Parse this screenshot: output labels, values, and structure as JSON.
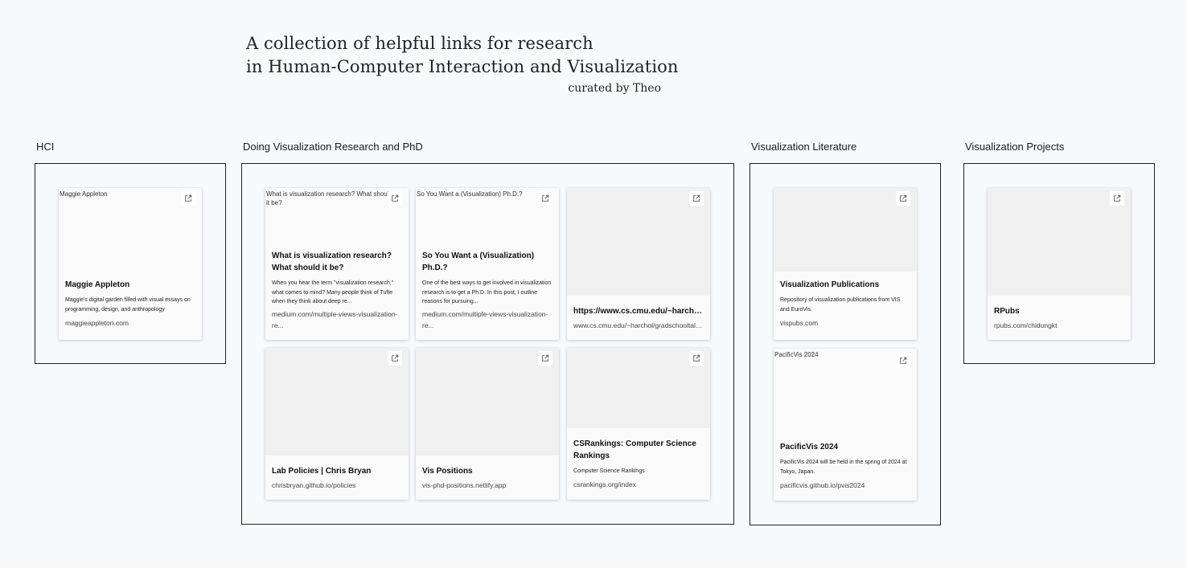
{
  "header": {
    "title_line1": "A collection of helpful links for research",
    "title_line2": "in Human-Computer Interaction and Visualization",
    "curator": "curated by Theo"
  },
  "sections": {
    "hci": {
      "title": "HCI",
      "cards": [
        {
          "image_alt": "Maggie Appleton",
          "title": "Maggie Appleton",
          "description": "Maggie's digital garden filled with visual essays on programming, design, and anthropology",
          "url": "maggieappleton.com"
        }
      ]
    },
    "phd": {
      "title": "Doing Visualization Research and PhD",
      "cards": [
        {
          "image_alt": "What is visualization research? What should it be?",
          "title": "What is visualization research? What should it be?",
          "description": "When you hear the term \"visualization research,\" what comes to mind? Many people think of Tufte when they think about deep re...",
          "url": "medium.com/multiple-views-visualization-re..."
        },
        {
          "image_alt": "So You Want a (Visualization) Ph.D.?",
          "title": "So You Want a (Visualization) Ph.D.?",
          "description": "One of the best ways to get involved in visualization research is to get a Ph.D. In this post, I outline reasons for pursuing...",
          "url": "medium.com/multiple-views-visualization-re..."
        },
        {
          "title": "https://www.cs.cmu.edu/~harchol/gradschooltalk.pdf",
          "url": "www.cs.cmu.edu/~harchol/gradschooltalk.pdf"
        },
        {
          "title": "Lab Policies | Chris Bryan",
          "url": "chrisbryan.github.io/policies"
        },
        {
          "title": "Vis Positions",
          "url": "vis-phd-positions.netlify.app"
        },
        {
          "title": "CSRankings: Computer Science Rankings",
          "description": "Computer Science Rankings",
          "url": "csrankings.org/index"
        }
      ]
    },
    "literature": {
      "title": "Visualization Literature",
      "cards": [
        {
          "title": "Visualization Publications",
          "description": "Repository of visualization publications from VIS and EuroVis.",
          "url": "vispubs.com"
        },
        {
          "image_alt": "PacificVis 2024",
          "title": "PacificVis 2024",
          "description": "PacificVis 2024 will be held in the spring of 2024 at Tokyo, Japan.",
          "url": "pacificvis.github.io/pvis2024"
        }
      ]
    },
    "projects": {
      "title": "Visualization Projects",
      "cards": [
        {
          "title": "RPubs",
          "url": "rpubs.com/chidungkt"
        }
      ]
    }
  },
  "icons": {
    "external_link": "external-link-icon"
  }
}
